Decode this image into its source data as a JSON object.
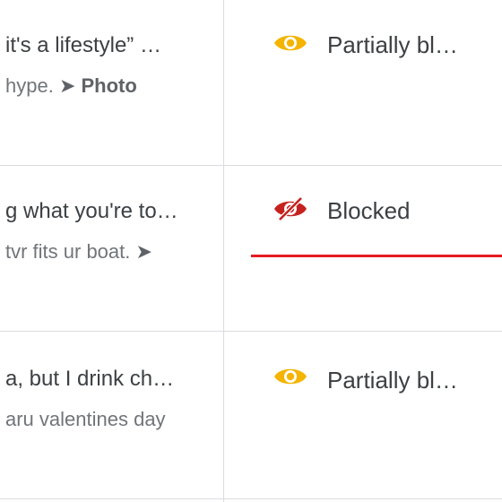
{
  "rows": [
    {
      "title": "it's a lifestyle” …",
      "snippet_text": "hype. ",
      "snippet_arrow": "➤",
      "snippet_bold": "Photo",
      "status": "Partially bl…",
      "status_icon": "eye-icon",
      "status_color": "#f4b400"
    },
    {
      "title": "g what you're to…",
      "snippet_text": "tvr fits ur boat. ",
      "snippet_arrow": "➤",
      "snippet_bold": "",
      "status": "Blocked",
      "status_icon": "eye-slash-icon",
      "status_color": "#c5221f",
      "underline_color": "#e51c23"
    },
    {
      "title": "a, but I drink ch…",
      "snippet_text": "aru valentines day",
      "snippet_arrow": "",
      "snippet_bold": "",
      "status": "Partially bl…",
      "status_icon": "eye-icon",
      "status_color": "#f4b400"
    }
  ]
}
